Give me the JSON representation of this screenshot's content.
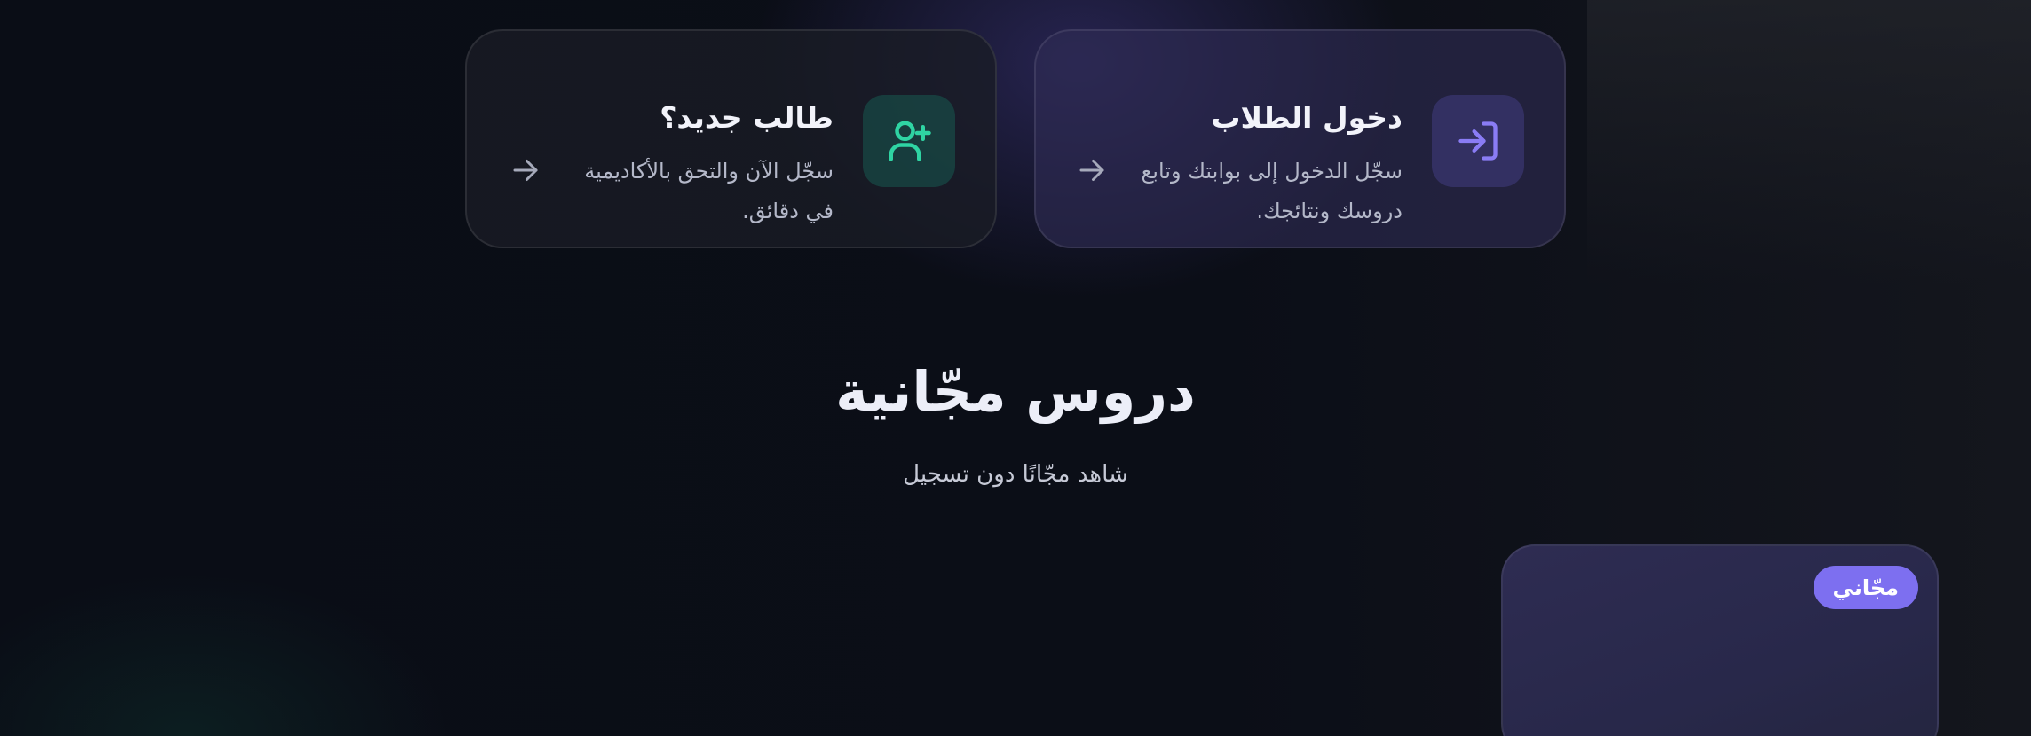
{
  "cards": {
    "login": {
      "title": "دخول الطلاب",
      "description": "سجّل الدخول إلى بوابتك وتابع دروسك ونتائجك.",
      "icon": "login-icon",
      "accent": "#8a7cf5"
    },
    "signup": {
      "title": "طالب جديد؟",
      "description": "سجّل الآن والتحق بالأكاديمية في دقائق.",
      "icon": "user-plus-icon",
      "accent": "#2fd4a3"
    }
  },
  "free_lessons": {
    "title": "دروس مجّانية",
    "subtitle": "شاهد مجّانًا دون تسجيل",
    "items": [
      {
        "badge": "مجّاني"
      }
    ]
  },
  "colors": {
    "background": "#0a0d16",
    "badge": "#7d6ff0",
    "muted_text": "#b4b8c9"
  }
}
